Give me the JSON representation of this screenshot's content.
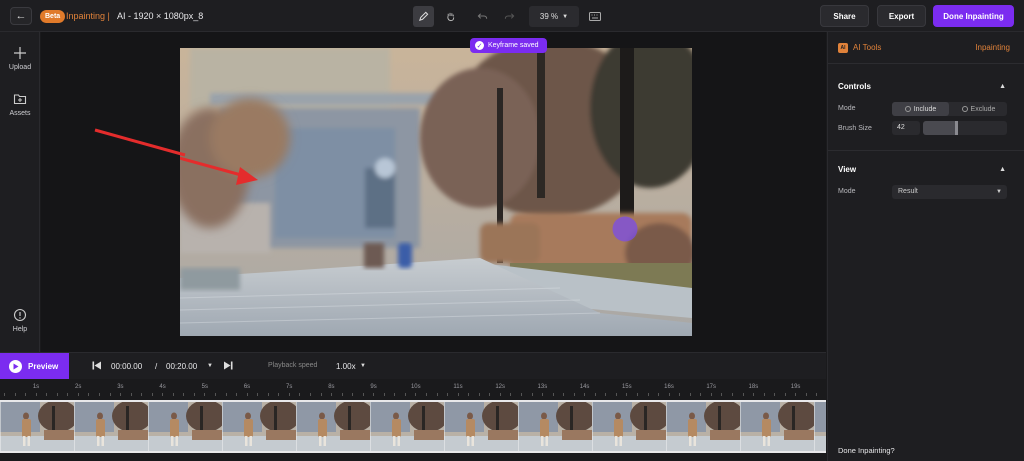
{
  "header": {
    "beta_badge": "Beta",
    "project_title": "Inpainting |",
    "project_name": "AI - 1920 × 1080px_8",
    "zoom_level": "39 %",
    "share_label": "Share",
    "export_label": "Export",
    "done_label": "Done Inpainting"
  },
  "sidebar": {
    "items": [
      {
        "label": "Upload",
        "icon": "plus-icon"
      },
      {
        "label": "Assets",
        "icon": "folder-icon"
      },
      {
        "label": "Help",
        "icon": "help-icon"
      }
    ]
  },
  "canvas": {
    "toast": "Keyframe saved"
  },
  "panel": {
    "badge": "AI",
    "title": "AI Tools",
    "mode_title": "Inpainting",
    "controls_title": "Controls",
    "mode_label": "Mode",
    "include_label": "Include",
    "exclude_label": "Exclude",
    "brush_size_label": "Brush Size",
    "brush_size_value": "42",
    "brush_size_fraction": 0.4,
    "view_title": "View",
    "view_mode_label": "Mode",
    "view_mode_value": "Result",
    "footer_text": "Done Inpainting?"
  },
  "playback": {
    "preview_label": "Preview",
    "current_time": "00:00.00",
    "separator": "/",
    "total_time": "00:20.00",
    "speed_label": "Playback speed",
    "speed_value": "1.00x"
  },
  "timeline": {
    "ticks": [
      "1s",
      "2s",
      "3s",
      "4s",
      "5s",
      "6s",
      "7s",
      "8s",
      "9s",
      "10s",
      "11s",
      "12s",
      "13s",
      "14s",
      "15s",
      "16s",
      "17s",
      "18s",
      "19s"
    ]
  },
  "colors": {
    "accent": "#7b2cf0",
    "brand_orange": "#e0823a"
  }
}
